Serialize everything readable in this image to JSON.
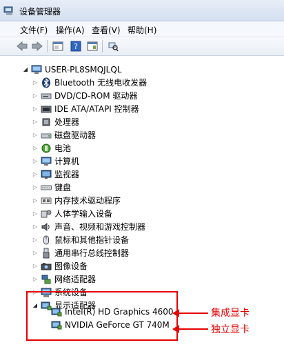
{
  "window": {
    "title": "设备管理器"
  },
  "menu": [
    "文件(F)",
    "操作(A)",
    "查看(V)",
    "帮助(H)"
  ],
  "toolbar": {
    "buttons": [
      "back-icon",
      "forward-icon",
      "properties-icon",
      "help-icon",
      "show-hidden-icon",
      "scan-hardware-icon"
    ]
  },
  "tree": {
    "root": "USER-PL8SMQJLQL",
    "categories": [
      {
        "label": "Bluetooth 无线电收发器",
        "icon": "bluetooth-icon"
      },
      {
        "label": "DVD/CD-ROM 驱动器",
        "icon": "optical-drive-icon"
      },
      {
        "label": "IDE ATA/ATAPI 控制器",
        "icon": "ide-controller-icon"
      },
      {
        "label": "处理器",
        "icon": "processor-icon"
      },
      {
        "label": "磁盘驱动器",
        "icon": "disk-drive-icon"
      },
      {
        "label": "电池",
        "icon": "battery-icon"
      },
      {
        "label": "计算机",
        "icon": "computer-icon"
      },
      {
        "label": "监视器",
        "icon": "monitor-icon"
      },
      {
        "label": "键盘",
        "icon": "keyboard-icon"
      },
      {
        "label": "内存技术驱动程序",
        "icon": "memory-icon"
      },
      {
        "label": "人体学输入设备",
        "icon": "hid-icon"
      },
      {
        "label": "声音、视频和游戏控制器",
        "icon": "sound-icon"
      },
      {
        "label": "鼠标和其他指针设备",
        "icon": "mouse-icon"
      },
      {
        "label": "通用串行总线控制器",
        "icon": "usb-icon"
      },
      {
        "label": "图像设备",
        "icon": "camera-icon"
      },
      {
        "label": "网络适配器",
        "icon": "network-icon"
      },
      {
        "label": "系统设备",
        "icon": "system-icon"
      },
      {
        "label": "显示适配器",
        "icon": "display-adapter-icon",
        "expanded": true
      }
    ],
    "display_adapters": [
      "Intel(R) HD Graphics 4600",
      "NVIDIA GeForce GT 740M"
    ]
  },
  "annotations": {
    "integrated": "集成显卡",
    "discrete": "独立显卡",
    "color": "#e60000"
  }
}
